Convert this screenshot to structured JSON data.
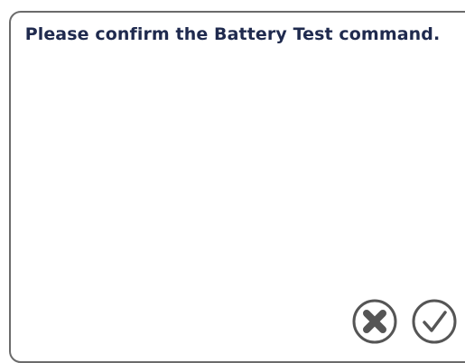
{
  "dialog": {
    "message": "Please confirm the Battery Test command.",
    "buttons": {
      "cancel": {
        "icon": "close-circle-icon",
        "action": "cancel"
      },
      "confirm": {
        "icon": "check-circle-icon",
        "action": "confirm"
      }
    }
  },
  "colors": {
    "text": "#1f2a4e",
    "border": "#6b6b6b",
    "icon": "#555555"
  }
}
